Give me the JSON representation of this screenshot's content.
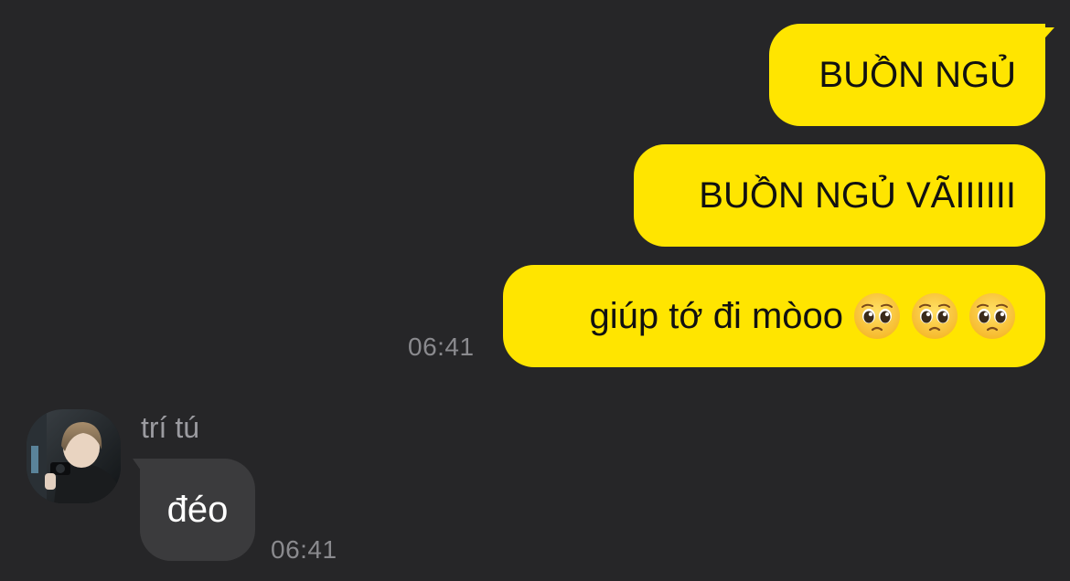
{
  "chat": {
    "outgoing": [
      {
        "text": "BUỒN NGỦ"
      },
      {
        "text": "BUỒN NGỦ VÃIIIIII"
      },
      {
        "text": "giúp tớ đi mòoo",
        "emojis": [
          "pleading-face-emoji",
          "pleading-face-emoji",
          "pleading-face-emoji"
        ]
      }
    ],
    "outgoing_time": "06:41",
    "incoming": {
      "sender": "trí tú",
      "text": "đéo",
      "time": "06:41"
    }
  },
  "colors": {
    "background": "#262628",
    "outgoing_bubble": "#FFE500",
    "incoming_bubble": "#3b3b3d",
    "timestamp": "#8a8a8e"
  }
}
